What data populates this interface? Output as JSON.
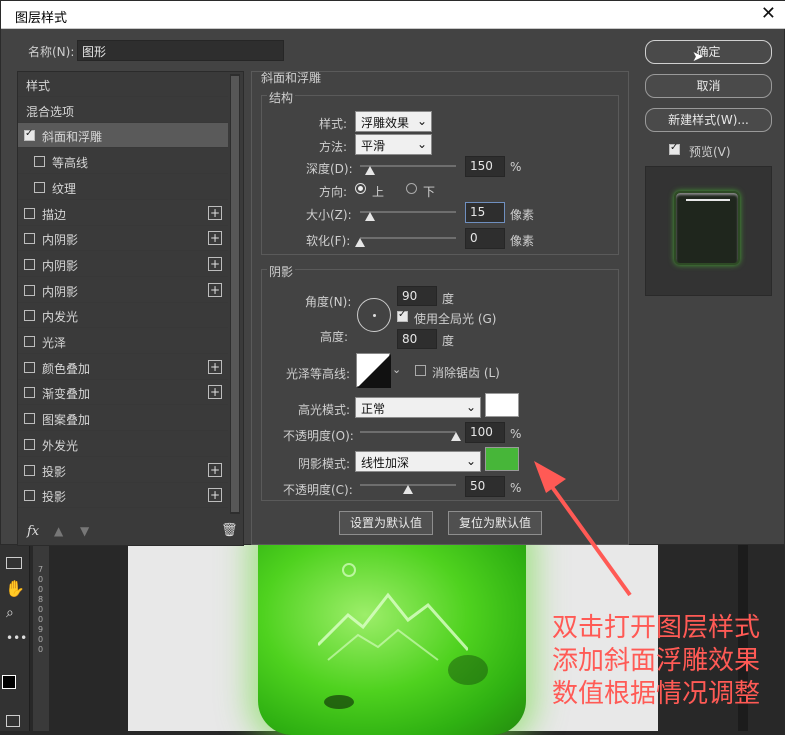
{
  "dialog": {
    "title": "图层样式",
    "close": "✕",
    "name_label": "名称(N):",
    "name_value": "图形"
  },
  "sidebar": {
    "items": [
      {
        "label": "样式",
        "checkbox": false,
        "checked": false,
        "plus": false,
        "indent": false
      },
      {
        "label": "混合选项",
        "checkbox": false,
        "checked": false,
        "plus": false,
        "indent": false
      },
      {
        "label": "斜面和浮雕",
        "checkbox": true,
        "checked": true,
        "plus": false,
        "indent": false,
        "selected": true
      },
      {
        "label": "等高线",
        "checkbox": true,
        "checked": false,
        "plus": false,
        "indent": true
      },
      {
        "label": "纹理",
        "checkbox": true,
        "checked": false,
        "plus": false,
        "indent": true
      },
      {
        "label": "描边",
        "checkbox": true,
        "checked": false,
        "plus": true,
        "indent": false
      },
      {
        "label": "内阴影",
        "checkbox": true,
        "checked": false,
        "plus": true,
        "indent": false
      },
      {
        "label": "内阴影",
        "checkbox": true,
        "checked": false,
        "plus": true,
        "indent": false
      },
      {
        "label": "内阴影",
        "checkbox": true,
        "checked": false,
        "plus": true,
        "indent": false
      },
      {
        "label": "内发光",
        "checkbox": true,
        "checked": false,
        "plus": false,
        "indent": false
      },
      {
        "label": "光泽",
        "checkbox": true,
        "checked": false,
        "plus": false,
        "indent": false
      },
      {
        "label": "颜色叠加",
        "checkbox": true,
        "checked": false,
        "plus": true,
        "indent": false
      },
      {
        "label": "渐变叠加",
        "checkbox": true,
        "checked": false,
        "plus": true,
        "indent": false
      },
      {
        "label": "图案叠加",
        "checkbox": true,
        "checked": false,
        "plus": false,
        "indent": false
      },
      {
        "label": "外发光",
        "checkbox": true,
        "checked": false,
        "plus": false,
        "indent": false
      },
      {
        "label": "投影",
        "checkbox": true,
        "checked": false,
        "plus": true,
        "indent": false
      },
      {
        "label": "投影",
        "checkbox": true,
        "checked": false,
        "plus": true,
        "indent": false
      }
    ],
    "fx": "fx"
  },
  "bevel": {
    "section_title": "斜面和浮雕",
    "structure_title": "结构",
    "style_label": "样式:",
    "style_value": "浮雕效果",
    "technique_label": "方法:",
    "technique_value": "平滑",
    "depth_label": "深度(D):",
    "depth_value": "150",
    "depth_unit": "%",
    "depth_level": 0.1,
    "direction_label": "方向:",
    "direction_up": "上",
    "direction_down": "下",
    "size_label": "大小(Z):",
    "size_value": "15",
    "size_unit": "像素",
    "size_level": 0.1,
    "soften_label": "软化(F):",
    "soften_value": "0",
    "soften_unit": "像素",
    "soften_level": 0.0
  },
  "shading": {
    "title": "阴影",
    "angle_label": "角度(N):",
    "angle_value": "90",
    "angle_unit": "度",
    "global_light_label": "使用全局光 (G)",
    "altitude_label": "高度:",
    "altitude_value": "80",
    "altitude_unit": "度",
    "gloss_contour_label": "光泽等高线:",
    "antialias_label": "消除锯齿 (L)",
    "highlight_mode_label": "高光模式:",
    "highlight_mode_value": "正常",
    "highlight_color": "#ffffff",
    "highlight_opacity_label": "不透明度(O):",
    "highlight_opacity_value": "100",
    "highlight_opacity_level": 1.0,
    "shadow_mode_label": "阴影模式:",
    "shadow_mode_value": "线性加深",
    "shadow_color": "#47b639",
    "shadow_opacity_label": "不透明度(C):",
    "shadow_opacity_value": "50",
    "shadow_opacity_level": 0.5,
    "percent": "%",
    "set_default": "设置为默认值",
    "reset_default": "复位为默认值"
  },
  "right": {
    "ok": "确定",
    "cancel": "取消",
    "new_style": "新建样式(W)...",
    "preview_label": "预览(V)"
  },
  "annotation": {
    "line1": "双击打开图层样式",
    "line2": "添加斜面浮雕效果",
    "line3": "数值根据情况调整",
    "color": "#ff5a55"
  },
  "ruler": [
    "7",
    "0",
    "0",
    "8",
    "0",
    "0",
    "9",
    "0",
    "0"
  ]
}
